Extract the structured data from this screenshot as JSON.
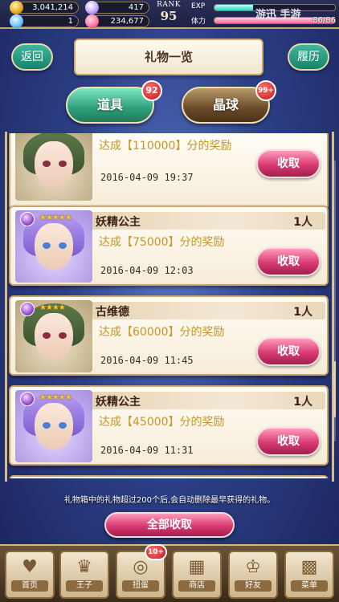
{
  "status": {
    "gold": "3,041,214",
    "crystal": "417",
    "gem": "1",
    "rose": "234,677",
    "rank_label": "RANK",
    "rank": "95",
    "exp_label": "EXP",
    "exp_fraction": 0.32,
    "stamina_label": "体力",
    "stamina": "86/86",
    "stamina_fraction": 1.0,
    "watermark": "游迅 手游"
  },
  "header": {
    "back_label": "返回",
    "title": "礼物一览",
    "history_label": "履历"
  },
  "tabs": [
    {
      "label": "道具",
      "badge": "92"
    },
    {
      "label": "晶球",
      "badge": "99+"
    }
  ],
  "gifts": [
    {
      "name": "",
      "count": "",
      "stars": "",
      "reward": "达成【110000】分的奖励",
      "date": "2016-04-09 19:37",
      "claim": "收取"
    },
    {
      "name": "妖精公主",
      "count": "1人",
      "stars": "★★★★★",
      "reward": "达成【75000】分的奖励",
      "date": "2016-04-09 12:03",
      "claim": "收取"
    },
    {
      "name": "古维德",
      "count": "1人",
      "stars": "★★★★",
      "reward": "达成【60000】分的奖励",
      "date": "2016-04-09 11:45",
      "claim": "收取"
    },
    {
      "name": "妖精公主",
      "count": "1人",
      "stars": "★★★★★",
      "reward": "达成【45000】分的奖励",
      "date": "2016-04-09 11:31",
      "claim": "收取"
    }
  ],
  "notice": "礼物箱中的礼物超过200个后,会自动删除最早获得的礼物。",
  "claim_all_label": "全部收取",
  "nav": {
    "home": "首页",
    "prince": "王子",
    "gift": "扭蛋",
    "shop": "商店",
    "friends": "好友",
    "menu": "菜单",
    "gift_badge": "10+"
  },
  "icons": {
    "home": "heart-icon",
    "prince": "crown-icon",
    "gift": "ring-icon",
    "shop": "shop-icon",
    "friends": "tiara-icon",
    "menu": "grid-icon"
  },
  "colors": {
    "accent_green": "#2e9f7a",
    "accent_pink": "#d93a72",
    "frame_gold": "#c9a86a",
    "reward_text": "#c5952a"
  }
}
